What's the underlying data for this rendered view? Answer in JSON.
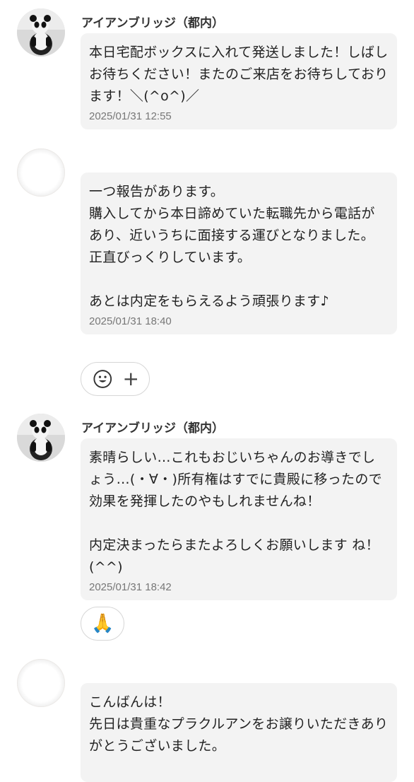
{
  "messages": [
    {
      "sender": "アイアンブリッジ（都内）",
      "text": "本日宅配ボックスに入れて発送しました！しばしお待ちください！またのご来店をお待ちしております！＼(^o^)／",
      "time": "2025/01/31 12:55"
    },
    {
      "sender": "",
      "text": "一つ報告があります。\n購入してから本日諦めていた転職先から電話があり、近いうちに面接する運びとなりました。\n正直びっくりしています。\n\nあとは内定をもらえるよう頑張ります♪",
      "time": "2025/01/31 18:40",
      "reaction_add": {
        "icon": "smiley-icon",
        "plus": "+"
      }
    },
    {
      "sender": "アイアンブリッジ（都内）",
      "text": "素晴らしい…これもおじいちゃんのお導きでしょう…(・∀・)所有権はすでに貴殿に移ったので効果を発揮したのやもしれませんね！\n\n内定決まったらまたよろしくお願いします ね！(^^)",
      "time": "2025/01/31 18:42",
      "reaction": {
        "emoji": "🙏"
      }
    },
    {
      "sender": "",
      "text": "こんばんは！\n先日は貴重なプラクルアンをお譲りいただきありがとうございました。"
    }
  ]
}
